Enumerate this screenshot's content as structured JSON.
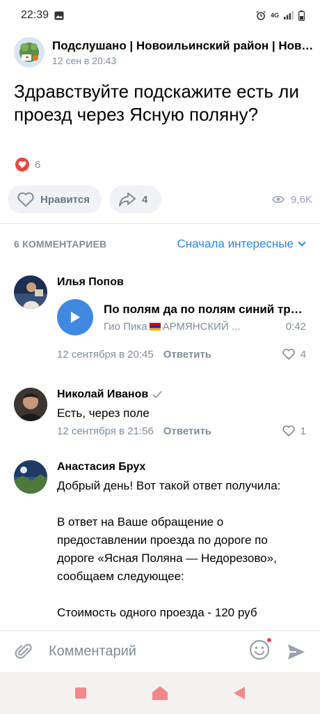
{
  "status_bar": {
    "time": "22:39",
    "network": "4G"
  },
  "post": {
    "group_name": "Подслушано | Новоильинский район | Новокузнецк",
    "date": "12 сен в 20:43",
    "text": "Здравствуйте подскажите есть ли проезд через Ясную поляну?",
    "reactions_count": "6",
    "like_label": "Нравится",
    "share_count": "4",
    "views": "9,6K"
  },
  "comments_header": {
    "count_label": "6 КОММЕНТАРИЕВ",
    "sort_label": "Сначала интересные"
  },
  "comments": [
    {
      "author": "Илья Попов",
      "audio": {
        "title": "По полям да по полям синий трактор едет к нам",
        "artist_prefix": "Гио Пика",
        "artist_rest": "АРМЯНСКИЙ ...",
        "duration": "0:42"
      },
      "date": "12 сентября в 20:45",
      "reply": "Ответить",
      "likes": "4"
    },
    {
      "author": "Николай Иванов",
      "verified": true,
      "text": "Есть, через поле",
      "date": "12 сентября в 21:56",
      "reply": "Ответить",
      "likes": "1"
    },
    {
      "author": "Анастасия Брух",
      "text": "Добрый день! Вот такой ответ получила:\n\nВ ответ на Ваше обращение о предоставлении проезда по дороге по дороге «Ясная Поляна — Недорезово», сообщаем следующее:\n\nСтоимость одного проезда - 120 руб"
    }
  ],
  "composer": {
    "placeholder": "Комментарий"
  },
  "colors": {
    "accent": "#2688eb",
    "like_red": "#e64646",
    "play_blue": "#3f8ae0",
    "secondary_text": "#818c99"
  },
  "icons": [
    "attach-icon",
    "emoji-icon",
    "send-icon",
    "heart-icon",
    "share-icon",
    "eye-icon",
    "play-icon",
    "chevron-down-icon",
    "verified-icon"
  ]
}
